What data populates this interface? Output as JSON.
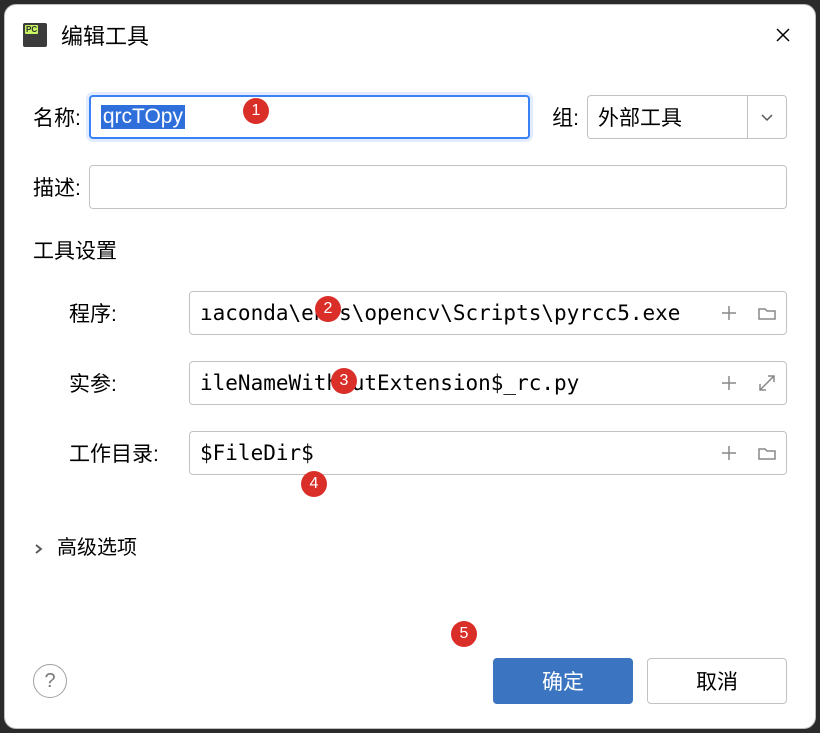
{
  "dialog": {
    "title": "编辑工具"
  },
  "labels": {
    "name": "名称:",
    "group": "组:",
    "description": "描述:",
    "tool_settings": "工具设置",
    "program": "程序:",
    "arguments": "实参:",
    "working_dir": "工作目录:",
    "advanced": "高级选项"
  },
  "values": {
    "name": "qrcTOpy",
    "group": "外部工具",
    "description": "",
    "program": "ıaconda\\envs\\opencv\\Scripts\\pyrcc5.exe",
    "arguments": "ileNameWithoutExtension$_rc.py",
    "working_dir": "$FileDir$"
  },
  "buttons": {
    "ok": "确定",
    "cancel": "取消"
  },
  "badges": {
    "b1": "1",
    "b2": "2",
    "b3": "3",
    "b4": "4",
    "b5": "5"
  }
}
